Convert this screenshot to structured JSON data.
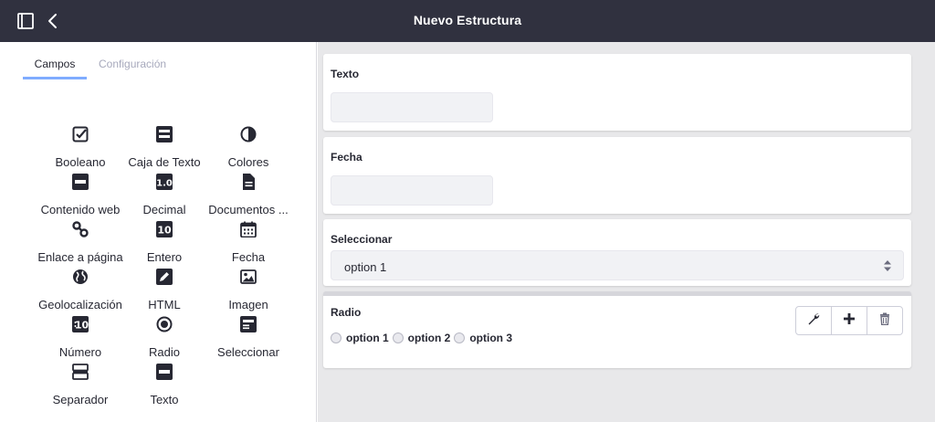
{
  "header": {
    "title": "Nuevo Estructura"
  },
  "tabs": {
    "campos": "Campos",
    "configuracion": "Configuración"
  },
  "fields": [
    {
      "label": "Booleano",
      "icon": "checkbox-icon"
    },
    {
      "label": "Caja de Texto",
      "icon": "text-box-icon"
    },
    {
      "label": "Colores",
      "icon": "color-contrast-icon"
    },
    {
      "label": "Contenido web",
      "icon": "web-content-icon"
    },
    {
      "label": "Decimal",
      "icon": "decimal-icon"
    },
    {
      "label": "Documentos ...",
      "icon": "document-icon"
    },
    {
      "label": "Enlace a página",
      "icon": "link-icon"
    },
    {
      "label": "Entero",
      "icon": "integer-icon"
    },
    {
      "label": "Fecha",
      "icon": "calendar-icon"
    },
    {
      "label": "Geolocalización",
      "icon": "globe-icon"
    },
    {
      "label": "HTML",
      "icon": "pencil-icon"
    },
    {
      "label": "Imagen",
      "icon": "image-icon"
    },
    {
      "label": "Número",
      "icon": "number-icon"
    },
    {
      "label": "Radio",
      "icon": "radio-icon"
    },
    {
      "label": "Seleccionar",
      "icon": "select-icon"
    },
    {
      "label": "Separador",
      "icon": "separator-icon"
    },
    {
      "label": "Texto",
      "icon": "text-icon"
    }
  ],
  "form": {
    "texto_label": "Texto",
    "fecha_label": "Fecha",
    "seleccionar_label": "Seleccionar",
    "seleccionar_value": "option 1",
    "radio_label": "Radio",
    "radio_options": [
      "option 1",
      "option 2",
      "option 3"
    ]
  },
  "colors": {
    "topbar": "#30313f",
    "active_tab_underline": "#80acff",
    "canvas_bg": "#e8e8ea"
  }
}
